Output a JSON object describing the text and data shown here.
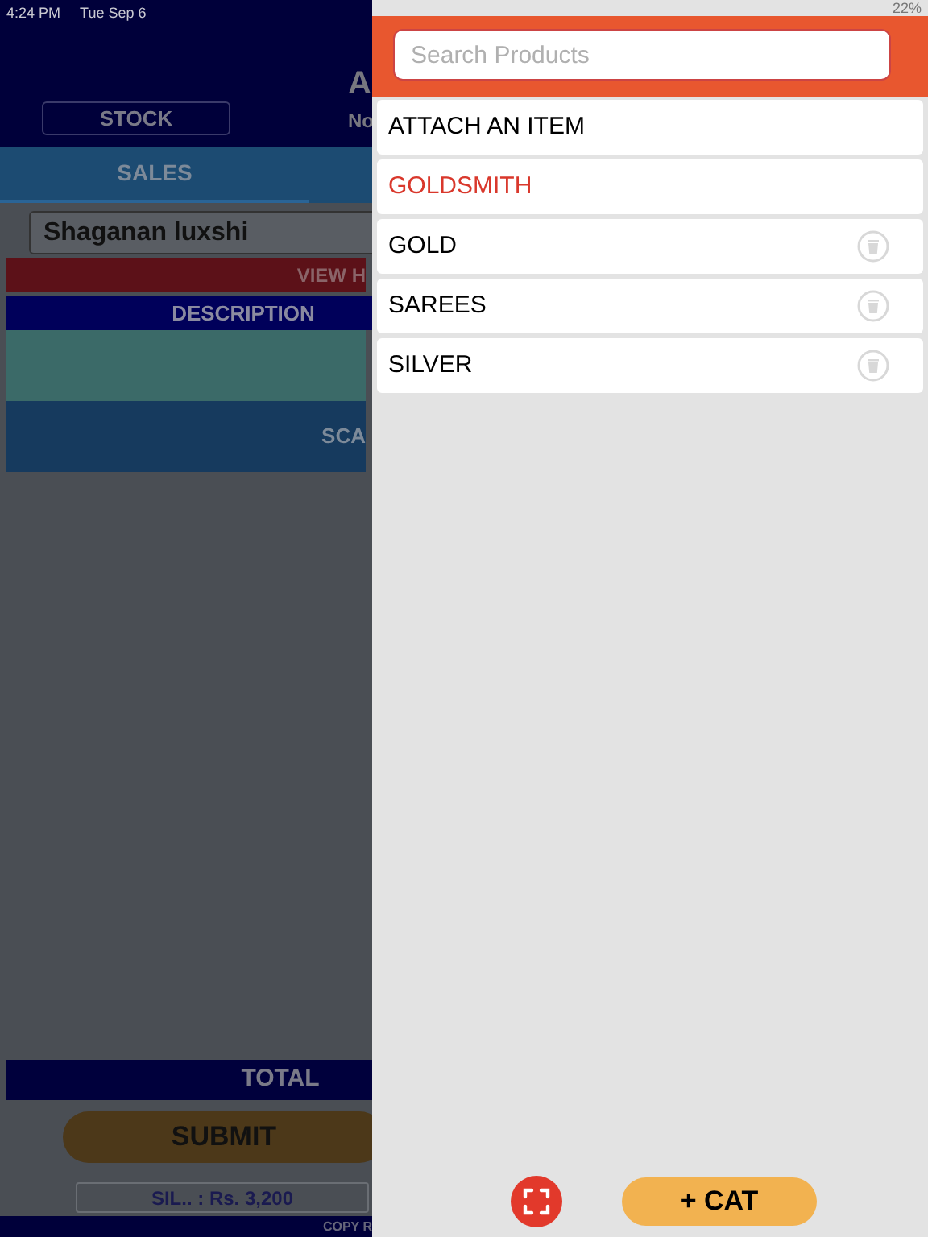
{
  "status_bar": {
    "time": "4:24 PM",
    "date": "Tue Sep 6",
    "battery": "22%"
  },
  "background_app": {
    "title": "A",
    "stock_button": "STOCK",
    "subtitle": "No",
    "tabs": [
      {
        "label": "SALES",
        "selected": true
      }
    ],
    "customer": "Shaganan luxshi",
    "history_bar": "VIEW H",
    "table_header": "DESCRIPTION",
    "scan_bar": "SCA",
    "total_bar": "TOTAL",
    "submit_button": "SUBMIT",
    "summary": "SIL.. : Rs. 3,200",
    "footer": "COPY R"
  },
  "drawer": {
    "search": {
      "placeholder": "Search Products"
    },
    "items": [
      {
        "label": "ATTACH AN ITEM",
        "selected": false,
        "deletable": false
      },
      {
        "label": "GOLDSMITH",
        "selected": true,
        "deletable": false
      },
      {
        "label": "GOLD",
        "selected": false,
        "deletable": true
      },
      {
        "label": "SAREES",
        "selected": false,
        "deletable": true
      },
      {
        "label": "SILVER",
        "selected": false,
        "deletable": true
      }
    ],
    "add_button": "+ CAT"
  }
}
